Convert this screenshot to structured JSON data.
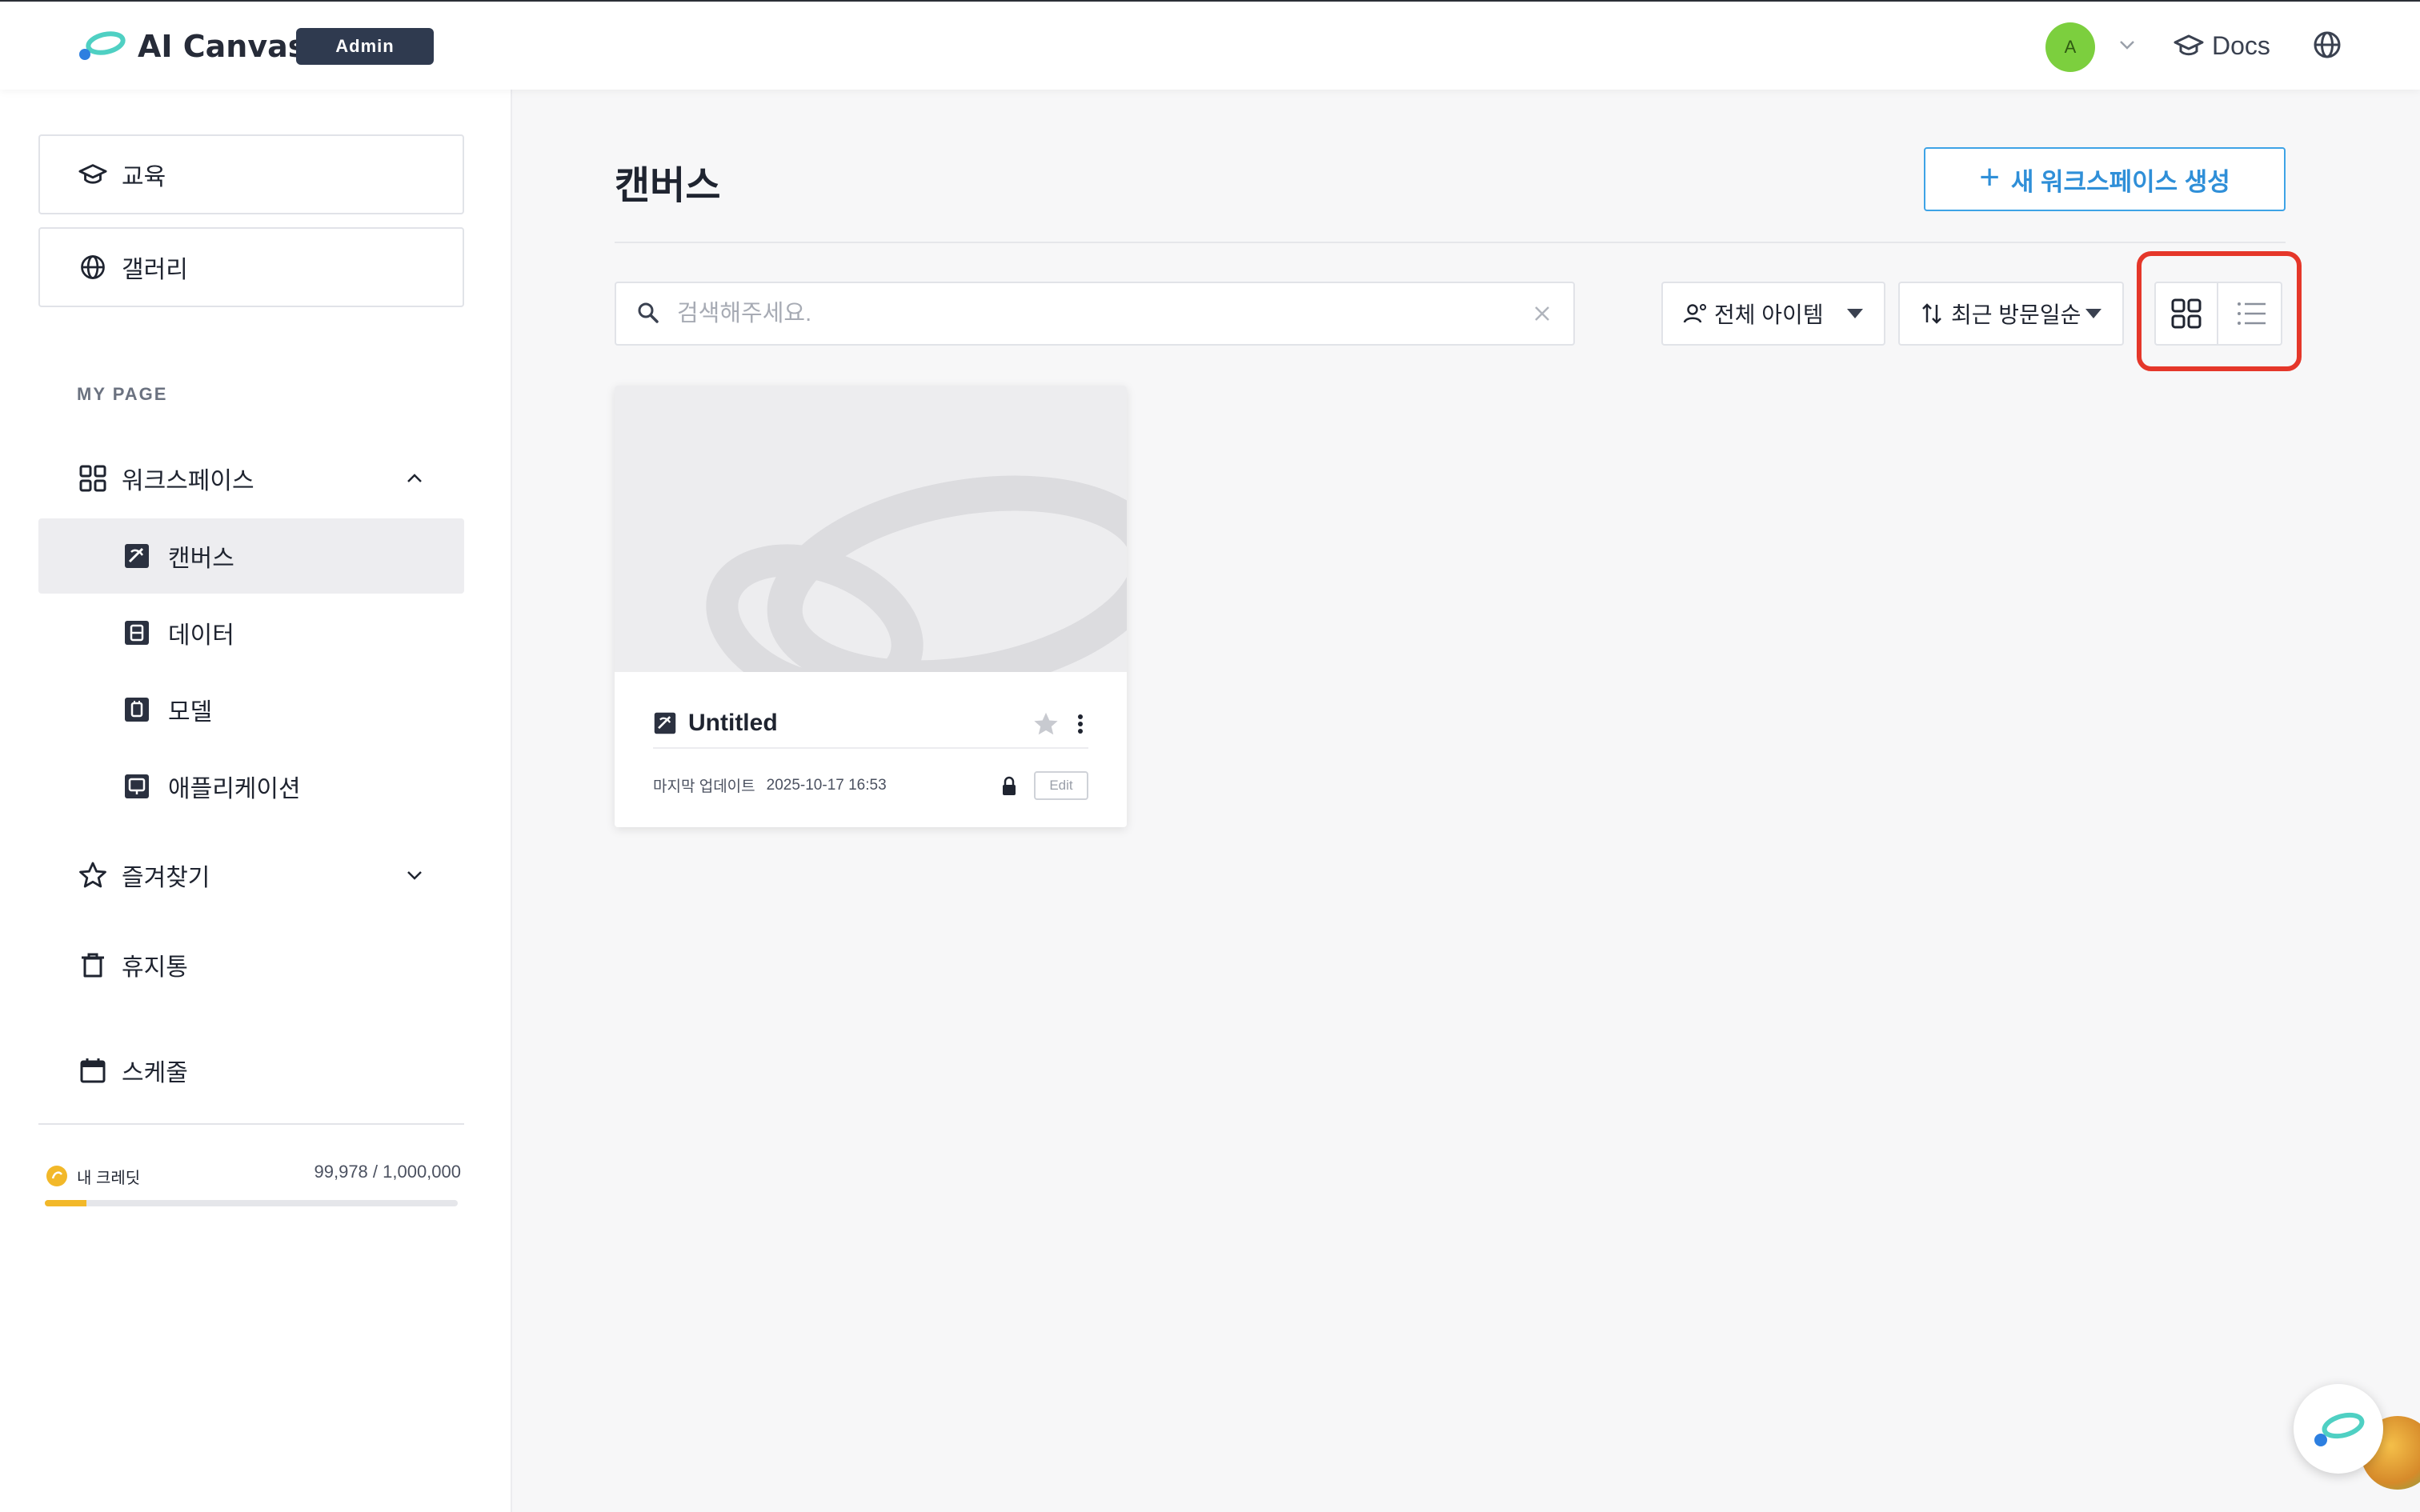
{
  "header": {
    "logo_text": "AI Canvas",
    "role_badge": "Admin",
    "avatar_initial": "A",
    "docs_label": "Docs"
  },
  "sidebar": {
    "top_boxes": [
      {
        "label": "교육",
        "icon": "graduation-cap-icon"
      },
      {
        "label": "갤러리",
        "icon": "globe-icon"
      }
    ],
    "section_label": "MY PAGE",
    "workspace": {
      "label": "워크스페이스",
      "icon": "grid-icon",
      "expanded": true
    },
    "sub_items": [
      {
        "label": "캔버스",
        "icon": "canvas-icon",
        "active": true
      },
      {
        "label": "데이터",
        "icon": "data-icon",
        "active": false
      },
      {
        "label": "모델",
        "icon": "model-icon",
        "active": false
      },
      {
        "label": "애플리케이션",
        "icon": "application-icon",
        "active": false
      }
    ],
    "favorites": {
      "label": "즐겨찾기",
      "icon": "star-icon",
      "expanded": false
    },
    "trash": {
      "label": "휴지통",
      "icon": "trash-icon"
    },
    "schedule": {
      "label": "스케줄",
      "icon": "calendar-icon"
    },
    "credit": {
      "label": "내 크레딧",
      "value_text": "99,978 / 1,000,000",
      "used": 99978,
      "total": 1000000
    }
  },
  "main": {
    "title": "캔버스",
    "create_button": "새 워크스페이스 생성",
    "search": {
      "placeholder": "검색해주세요.",
      "value": ""
    },
    "filter_select": "전체 아이템",
    "sort_select": "최근 방문일순",
    "view_mode": "grid"
  },
  "cards": [
    {
      "title": "Untitled",
      "meta_label": "마지막 업데이트",
      "updated": "2025-10-17 16:53",
      "tag": "Edit",
      "locked": true,
      "starred": false
    }
  ],
  "colors": {
    "accent": "#3ea3e6",
    "highlight": "#e5372a",
    "credit_fill": "#f2b829",
    "admin_badge": "#2f3a4f",
    "avatar": "#7ccf3e"
  }
}
